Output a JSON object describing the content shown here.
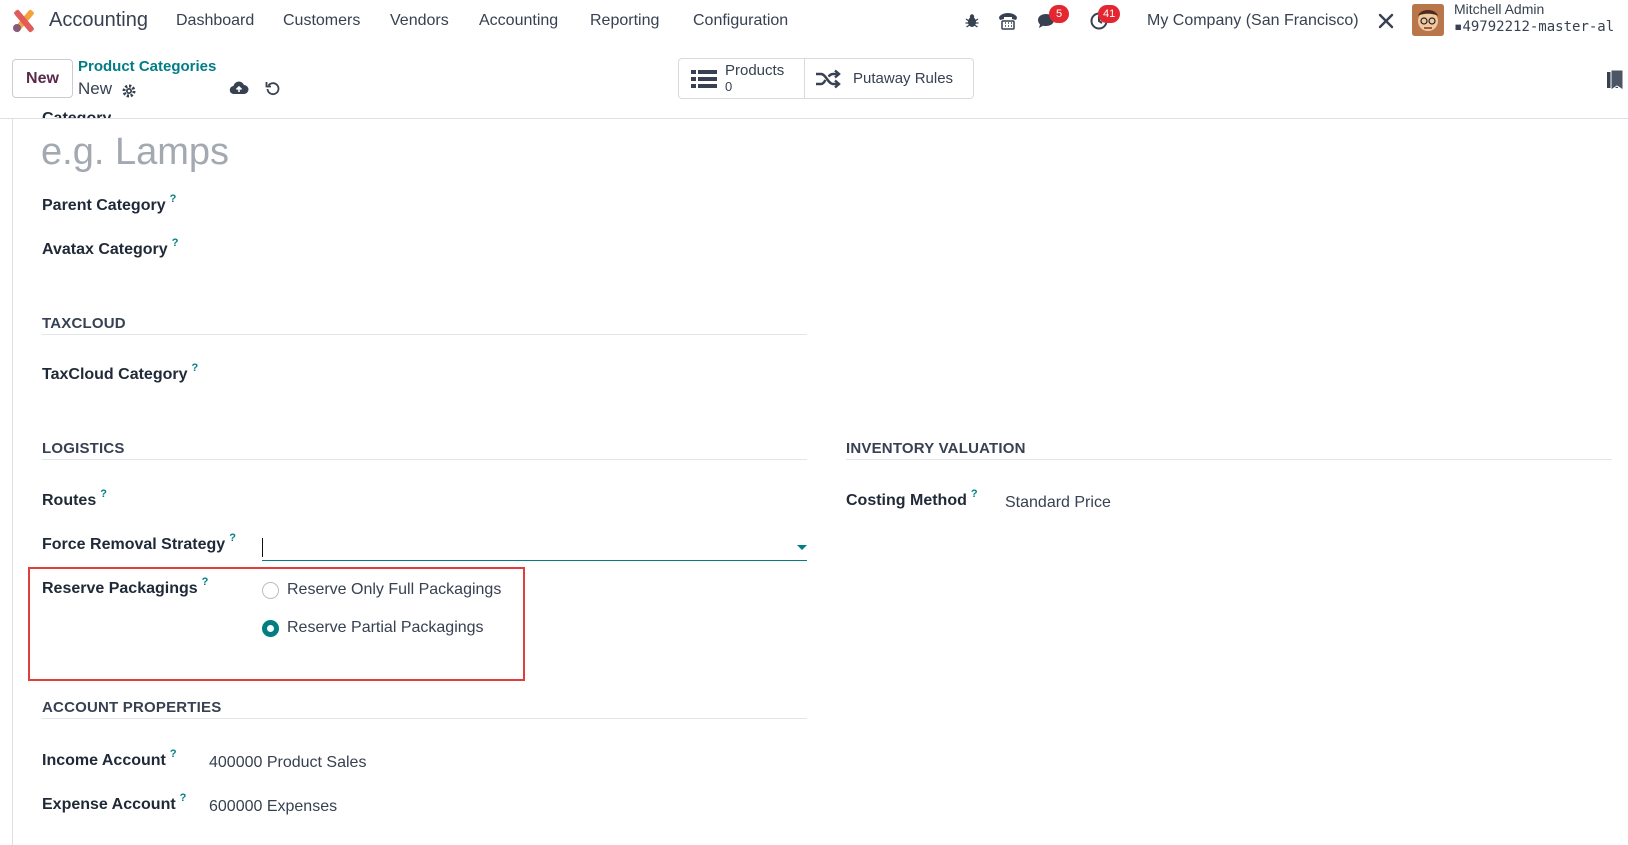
{
  "navbar": {
    "app_name": "Accounting",
    "menu": [
      "Dashboard",
      "Customers",
      "Vendors",
      "Accounting",
      "Reporting",
      "Configuration"
    ],
    "messages_badge": "5",
    "activities_badge": "41",
    "company": "My Company (San Francisco)",
    "user_name": "Mitchell Admin",
    "database": "49792212-master-al",
    "icons": [
      "bug-icon",
      "phone-icon",
      "chat-icon",
      "clock-icon",
      "tools-icon"
    ]
  },
  "control_panel": {
    "new_label": "New",
    "breadcrumb_parent": "Product Categories",
    "breadcrumb_current": "New",
    "smart_products_label": "Products",
    "smart_products_count": "0",
    "smart_putaway_label": "Putaway Rules"
  },
  "form": {
    "category_label": "Category",
    "name_placeholder": "e.g. Lamps",
    "parent_category_label": "Parent Category",
    "avatax_category_label": "Avatax Category",
    "help_mark": "?",
    "taxcloud": {
      "title": "TAXCLOUD",
      "category_label": "TaxCloud Category"
    },
    "logistics": {
      "title": "LOGISTICS",
      "routes_label": "Routes",
      "force_removal_label": "Force Removal Strategy",
      "force_removal_value": "",
      "reserve_packagings_label": "Reserve Packagings",
      "options": [
        {
          "label": "Reserve Only Full Packagings",
          "checked": false
        },
        {
          "label": "Reserve Partial Packagings",
          "checked": true
        }
      ]
    },
    "inventory_valuation": {
      "title": "INVENTORY VALUATION",
      "costing_method_label": "Costing Method",
      "costing_method_value": "Standard Price"
    },
    "account_properties": {
      "title": "ACCOUNT PROPERTIES",
      "income_label": "Income Account",
      "income_value": "400000 Product Sales",
      "expense_label": "Expense Account",
      "expense_value": "600000 Expenses"
    }
  },
  "colors": {
    "accent": "#017e84",
    "brand": "#714b67",
    "badge": "#e3262f",
    "highlight": "#e03d3d"
  }
}
